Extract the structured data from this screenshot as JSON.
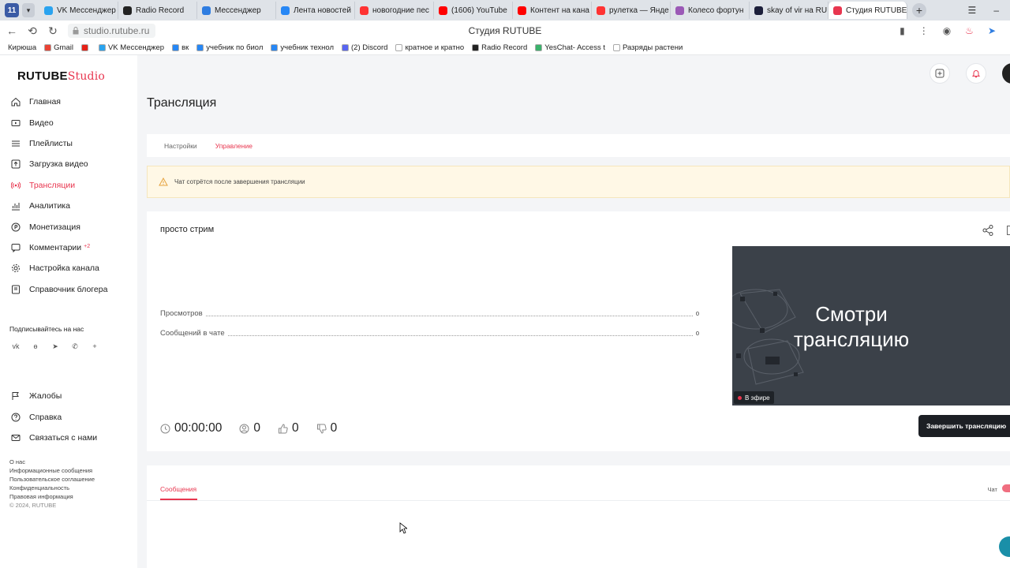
{
  "browser": {
    "workspace_label": "11",
    "tabs": [
      {
        "label": "VK Мессенджер",
        "color": "#2aa3ef"
      },
      {
        "label": "Radio Record",
        "color": "#222222"
      },
      {
        "label": "Мессенджер",
        "color": "#2f7de1"
      },
      {
        "label": "Лента новостей",
        "color": "#2787f5"
      },
      {
        "label": "новогодние пес",
        "color": "#f33"
      },
      {
        "label": "(1606) YouTube",
        "color": "#f00"
      },
      {
        "label": "Контент на кана",
        "color": "#f00"
      },
      {
        "label": "рулетка — Янде",
        "color": "#f33"
      },
      {
        "label": "Колесо фортун",
        "color": "#9b59b6"
      },
      {
        "label": "skay of vir на RU",
        "color": "#1c1f3a"
      },
      {
        "label": "Студия RUTUBE",
        "color": "#e8364f",
        "active": true
      }
    ],
    "url": "studio.rutube.ru",
    "page_title": "Студия RUTUBE",
    "bookmarks": [
      {
        "label": "Кирюша",
        "color": "#ffffff"
      },
      {
        "label": "Gmail",
        "color": "#ea4335"
      },
      {
        "label": "",
        "color": "#e62117"
      },
      {
        "label": "VK Мессенджер",
        "color": "#2aa3ef"
      },
      {
        "label": "вк",
        "color": "#2787f5"
      },
      {
        "label": "учебник по биол",
        "color": "#2787f5"
      },
      {
        "label": "учебник технол",
        "color": "#2787f5"
      },
      {
        "label": "(2) Discord",
        "color": "#5865f2"
      },
      {
        "label": "кратное и кратно",
        "color": "#ffffff"
      },
      {
        "label": "Radio Record",
        "color": "#222222"
      },
      {
        "label": "YesChat- Access t",
        "color": "#3ab26b"
      },
      {
        "label": "Разряды растени",
        "color": "#ffffff"
      }
    ]
  },
  "sidebar": {
    "logo_main": "RUTUBE",
    "logo_accent": "Studio",
    "items": [
      {
        "label": "Главная",
        "icon": "home-icon"
      },
      {
        "label": "Видео",
        "icon": "video-icon"
      },
      {
        "label": "Плейлисты",
        "icon": "playlist-icon"
      },
      {
        "label": "Загрузка видео",
        "icon": "upload-icon"
      },
      {
        "label": "Трансляции",
        "icon": "broadcast-icon",
        "active": true
      },
      {
        "label": "Аналитика",
        "icon": "analytics-icon"
      },
      {
        "label": "Монетизация",
        "icon": "monetization-icon"
      },
      {
        "label": "Комментарии",
        "icon": "comments-icon",
        "badge": "+2"
      },
      {
        "label": "Настройка канала",
        "icon": "settings-icon"
      },
      {
        "label": "Справочник блогера",
        "icon": "book-icon"
      }
    ],
    "subscribe_title": "Подписывайтесь на нас",
    "socials": [
      "vk-icon",
      "ok-icon",
      "telegram-icon",
      "viber-icon",
      "plus-icon"
    ],
    "items2": [
      {
        "label": "Жалобы",
        "icon": "flag-icon"
      },
      {
        "label": "Справка",
        "icon": "help-icon"
      },
      {
        "label": "Связаться с нами",
        "icon": "mail-icon"
      }
    ],
    "footer_links": [
      "О нас",
      "Информационные сообщения",
      "Пользовательское соглашение",
      "Конфиденциальность",
      "Правовая информация"
    ],
    "copyright": "© 2024, RUTUBE"
  },
  "main": {
    "title": "Трансляция",
    "tabs": [
      {
        "label": "Настройки"
      },
      {
        "label": "Управление",
        "active": true
      }
    ],
    "warning": "Чат сотрётся после завершения трансляции",
    "stream": {
      "name": "просто стрим",
      "stats": [
        {
          "label": "Просмотров",
          "value": "0"
        },
        {
          "label": "Сообщений в чате",
          "value": "0"
        }
      ],
      "timer": "00:00:00",
      "viewers": "0",
      "likes": "0",
      "dislikes": "0",
      "preview_text_line1": "Смотри",
      "preview_text_line2": "трансляцию",
      "live_label": "В эфире",
      "end_button": "Завершить трансляцию"
    },
    "chat": {
      "tab_label": "Сообщения",
      "toggle_label": "Чат"
    }
  },
  "colors": {
    "accent": "#e8364f",
    "warning_bg": "#fff8e6"
  }
}
